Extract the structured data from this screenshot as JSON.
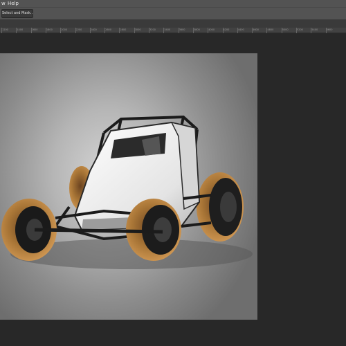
{
  "menubar": {
    "items": [
      "w",
      "Help"
    ]
  },
  "options_bar": {
    "select_and_mask_label": "Select and Mask..."
  },
  "ruler": {
    "labels": [
      "1200",
      "1400",
      "1600",
      "1800",
      "2000",
      "2200",
      "2400",
      "2600",
      "2800",
      "3000",
      "3200",
      "3400",
      "3600",
      "3800",
      "4000",
      "4200",
      "4400",
      "4600",
      "4800",
      "5000",
      "5200",
      "5400",
      "5600"
    ]
  },
  "canvas": {
    "subject": "sprint-car-illustration",
    "background": "gray-radial-gradient"
  },
  "colors": {
    "ui_panel": "#535353",
    "workspace": "#282828",
    "tire_tan": "#b07a3a",
    "body_white": "#f0f0f0"
  }
}
